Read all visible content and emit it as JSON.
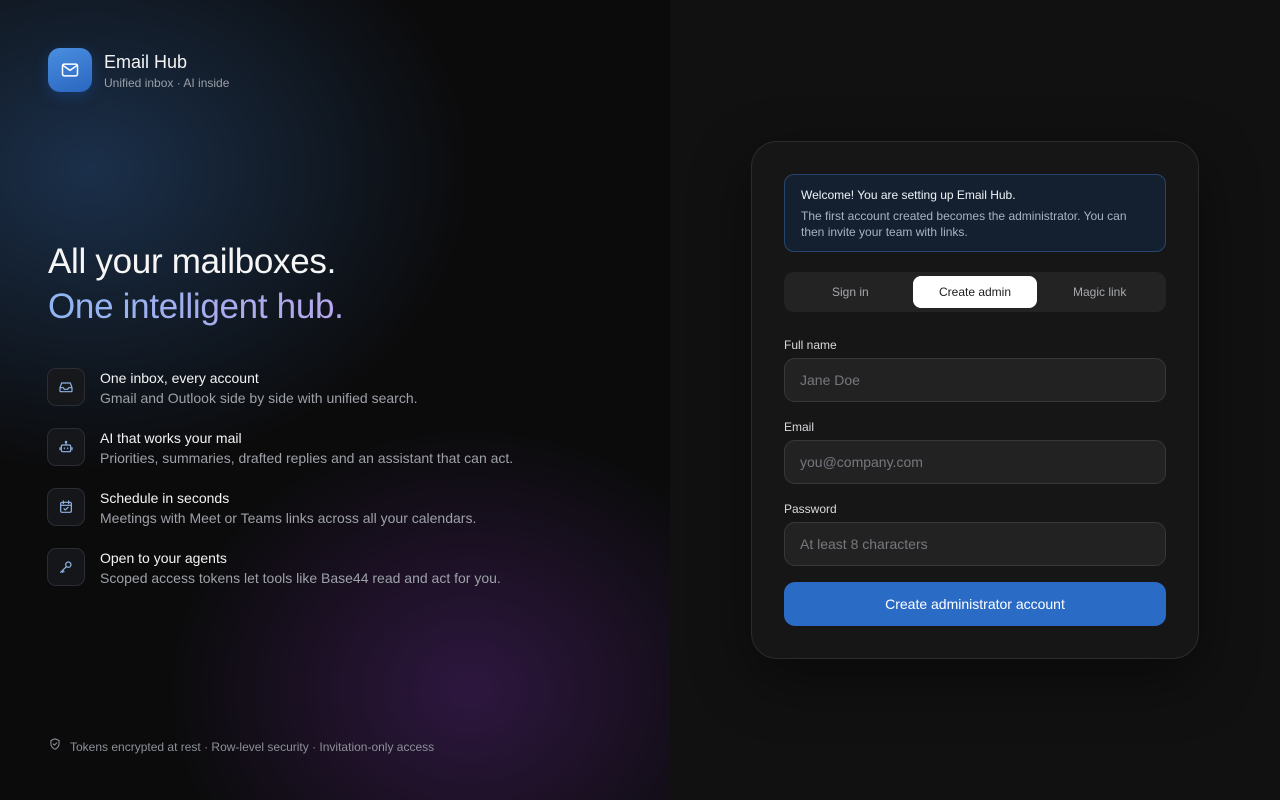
{
  "brand": {
    "name": "Email Hub",
    "tagline": "Unified inbox · AI inside"
  },
  "hero": {
    "line1": "All your mailboxes.",
    "line2": "One intelligent hub."
  },
  "features": [
    {
      "icon": "inbox-icon",
      "title": "One inbox, every account",
      "desc": "Gmail and Outlook side by side with unified search."
    },
    {
      "icon": "bot-icon",
      "title": "AI that works your mail",
      "desc": "Priorities, summaries, drafted replies and an assistant that can act."
    },
    {
      "icon": "calendar-check-icon",
      "title": "Schedule in seconds",
      "desc": "Meetings with Meet or Teams links across all your calendars."
    },
    {
      "icon": "key-icon",
      "title": "Open to your agents",
      "desc": "Scoped access tokens let tools like Base44 read and act for you."
    }
  ],
  "footer": {
    "icon": "shield-check-icon",
    "text": "Tokens encrypted at rest · Row-level security · Invitation-only access"
  },
  "notice": {
    "title": "Welcome! You are setting up Email Hub.",
    "body": "The first account created becomes the administrator. You can then invite your team with links."
  },
  "tabs": [
    {
      "label": "Sign in",
      "active": false
    },
    {
      "label": "Create admin",
      "active": true
    },
    {
      "label": "Magic link",
      "active": false
    }
  ],
  "form": {
    "full_name": {
      "label": "Full name",
      "placeholder": "Jane Doe",
      "value": ""
    },
    "email": {
      "label": "Email",
      "placeholder": "you@company.com",
      "value": ""
    },
    "password": {
      "label": "Password",
      "placeholder": "At least 8 characters",
      "value": ""
    },
    "submit_label": "Create administrator account"
  },
  "colors": {
    "accent": "#2a6bc6",
    "brand_gradient_start": "#4a8fe0",
    "hero_gradient_start": "#8fb6f2",
    "hero_gradient_end": "#b8a6ec",
    "notice_border": "#25476f"
  }
}
